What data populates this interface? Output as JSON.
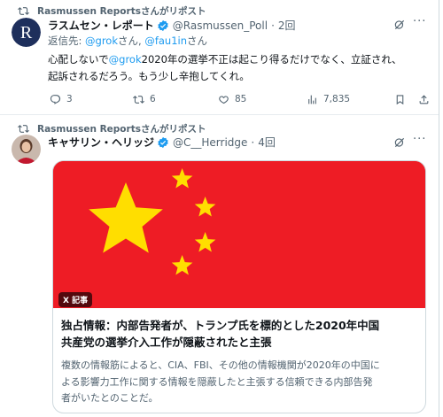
{
  "post1": {
    "repost_label": "Rasmussen Reportsさんがリポスト",
    "author_name": "ラスムセン・レポート",
    "handle": "@Rasmussen_Poll",
    "time": "2回",
    "reply_prefix": "返信先: ",
    "reply_mention1": "@grok",
    "reply_mid": "さん, ",
    "reply_mention2": "@fau1in",
    "reply_suffix": "さん",
    "text_line1_pre": "心配しないで",
    "text_line1_mention": "@grok",
    "text_line1_post": "2020年の選挙不正は起こり得るだけでなく、立証され、",
    "text_line2": "起訴されるだろう。もう少し辛抱してくれ。",
    "replies": "3",
    "reposts": "6",
    "likes": "85",
    "views": "7,835"
  },
  "post2": {
    "repost_label": "Rasmussen Reportsさんがリポスト",
    "author_name": "キャサリン・ヘリッジ",
    "handle": "@C__Herridge",
    "time": "4回",
    "card": {
      "source_badge": "X 記事",
      "title_line1": "独占情報：内部告発者が、トランプ氏を標的とした2020年中国",
      "title_line2": "共産党の選挙介入工作が隠蔽されたと主張",
      "desc_line1": "複数の情報筋によると、CIA、FBI、その他の情報機関が2020年の中国に",
      "desc_line2": "よる影響力工作に関する情報を隠蔽したと主張する信頼できる内部告発",
      "desc_line3": "者がいたとのことだ。"
    }
  },
  "colors": {
    "accent": "#1d9bf0",
    "muted": "#536471",
    "flag_red": "#ee1c25",
    "flag_star": "#ffde00"
  },
  "icons": [
    "repost-icon",
    "verified-badge-icon",
    "grok-icon",
    "more-icon",
    "reply-icon",
    "like-icon",
    "views-icon"
  ]
}
